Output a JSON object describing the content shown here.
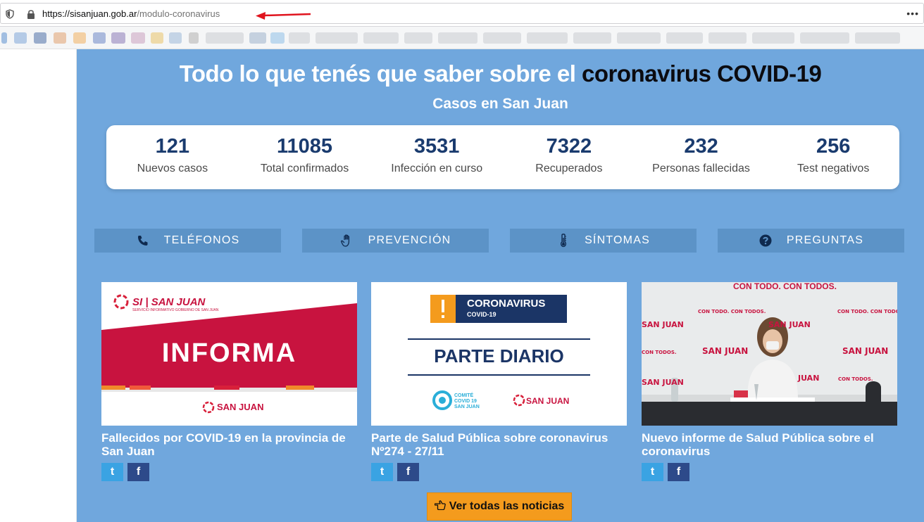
{
  "browser": {
    "url_host": "https://sisanjuan.gob.ar",
    "url_path": "/modulo-coronavirus",
    "more_label": "•••"
  },
  "page": {
    "title_light": "Todo lo que tenés que saber sobre el ",
    "title_dark": "coronavirus COVID-19",
    "subtitle": "Casos en San Juan"
  },
  "stats": [
    {
      "value": "121",
      "label": "Nuevos casos"
    },
    {
      "value": "11085",
      "label": "Total confirmados"
    },
    {
      "value": "3531",
      "label": "Infección en curso"
    },
    {
      "value": "7322",
      "label": "Recuperados"
    },
    {
      "value": "232",
      "label": "Personas fallecidas"
    },
    {
      "value": "256",
      "label": "Test negativos"
    }
  ],
  "nav": [
    {
      "label": "TELÉFONOS",
      "icon": "phone-icon"
    },
    {
      "label": "PREVENCIÓN",
      "icon": "hand-icon"
    },
    {
      "label": "SÍNTOMAS",
      "icon": "thermometer-icon"
    },
    {
      "label": "PREGUNTAS",
      "icon": "question-icon"
    }
  ],
  "cards": [
    {
      "title": "Fallecidos por COVID-19 en la provincia de San Juan",
      "img_logo_text": "SI | SAN JUAN",
      "img_sublogo": "SERVICIO INFORMATIVO GOBIERNO DE SAN JUAN",
      "img_main_text": "INFORMA",
      "img_footer_text": "SAN JUAN"
    },
    {
      "title": "Parte de Salud Pública sobre coronavirus Nº274 - 27/11",
      "img_banner_main": "CORONAVIRUS",
      "img_banner_sub": "COVID-19",
      "img_main_text": "PARTE DIARIO",
      "img_comite": "COMITÉ COVID 19 SAN JUAN",
      "img_footer_text": "SAN JUAN"
    },
    {
      "title": "Nuevo informe de Salud Pública sobre el coronavirus",
      "img_top_text": "CON TODO. CON TODOS.",
      "img_brand": "SAN JUAN",
      "img_small": "CON TODO. CON TODOS."
    }
  ],
  "share": {
    "twitter": "t",
    "facebook": "f"
  },
  "more_news": {
    "label": "Ver todas las noticias",
    "icon": "hand-pointer-icon"
  },
  "colors": {
    "page_bg": "#70a7dd",
    "nav_bg": "#5c93c7",
    "stat_value": "#1a3b6e",
    "orange": "#f49b1d",
    "twitter": "#3aa3e3",
    "facebook": "#2d4a8a"
  }
}
